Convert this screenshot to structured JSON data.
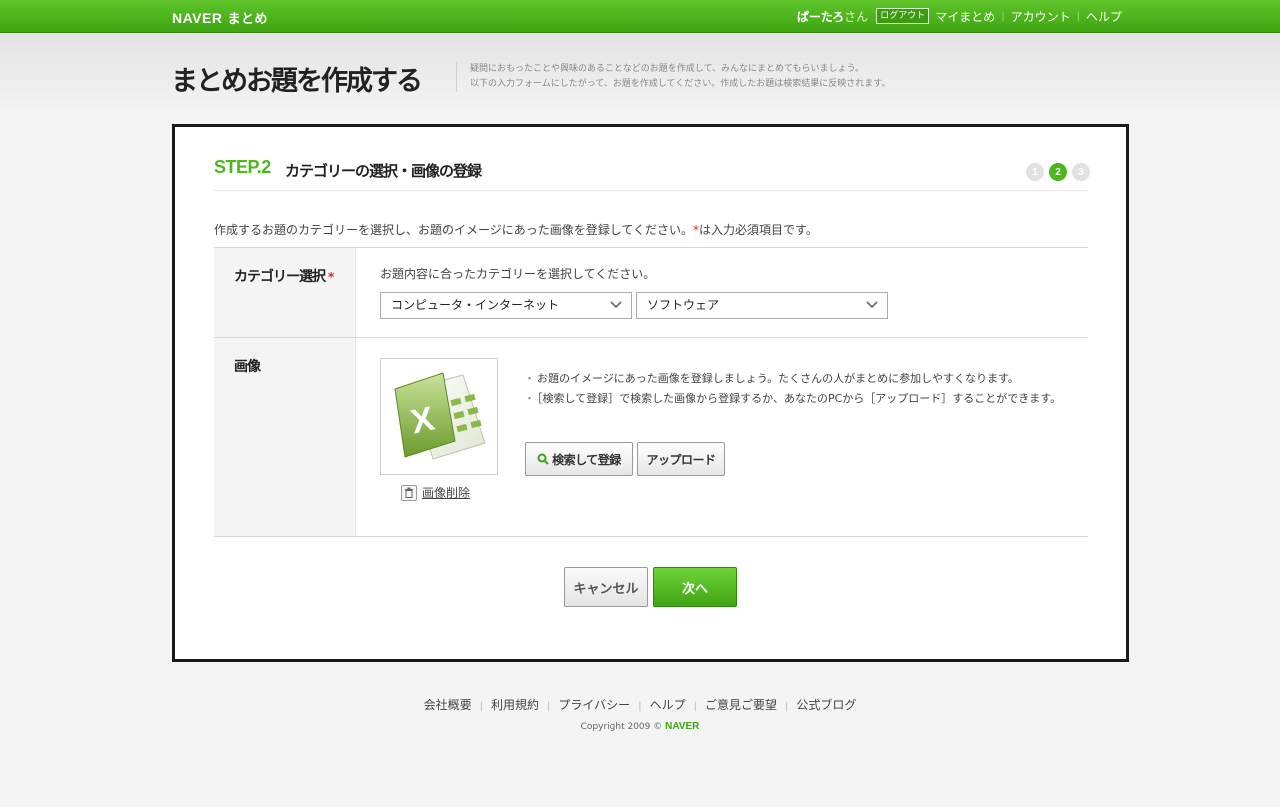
{
  "header": {
    "logo": "NAVER",
    "logo_sub": "まとめ",
    "username": "ぱーたろ",
    "honorific": "さん",
    "logout": "ログアウト",
    "nav": [
      "マイまとめ",
      "アカウント",
      "ヘルプ"
    ]
  },
  "page": {
    "title": "まとめお題を作成する",
    "desc_line1": "疑問におもったことや興味のあることなどのお題を作成して、みんなにまとめてもらいましょう。",
    "desc_line2": "以下の入力フォームにしたがって、お題を作成してください。作成したお題は検索結果に反映されます。"
  },
  "step": {
    "label": "STEP.2",
    "title": "カテゴリーの選択・画像の登録",
    "dots": [
      "1",
      "2",
      "3"
    ],
    "current": 2
  },
  "intro": {
    "text": "作成するお題のカテゴリーを選択し、お題のイメージにあった画像を登録してください。",
    "req_mark": "*",
    "req_note": "は入力必須項目です。"
  },
  "category": {
    "label": "カテゴリー選択",
    "req_mark": "*",
    "hint": "お題内容に合ったカテゴリーを選択してください。",
    "main_value": "コンピュータ・インターネット",
    "sub_value": "ソフトウェア"
  },
  "image": {
    "label": "画像",
    "delete": "画像削除",
    "bullet1": "お題のイメージにあった画像を登録しましょう。たくさんの人がまとめに参加しやすくなります。",
    "bullet2": "［検索して登録］で検索した画像から登録するか、あなたのPCから［アップロード］することができます。",
    "search_button": "検索して登録",
    "upload_button": "アップロード"
  },
  "actions": {
    "cancel": "キャンセル",
    "next": "次へ"
  },
  "footer": {
    "links": [
      "会社概要",
      "利用規約",
      "プライバシー",
      "ヘルプ",
      "ご意見ご要望",
      "公式ブログ"
    ],
    "copyright": "Copyright 2009 ©",
    "brand": "NAVER"
  },
  "colors": {
    "brand_green": "#4cb81c",
    "required_red": "#dd2222"
  }
}
